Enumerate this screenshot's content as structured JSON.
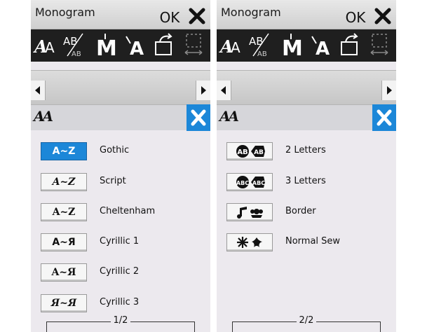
{
  "panels": [
    {
      "title": "Monogram",
      "ok_label": "OK",
      "subheader_icon": "AA",
      "items": [
        {
          "button": "A~Z",
          "label": "Gothic"
        },
        {
          "button": "A~Z",
          "label": "Script"
        },
        {
          "button": "A~Z",
          "label": "Cheltenham"
        },
        {
          "button": "A~Я",
          "label": "Cyrillic 1"
        },
        {
          "button": "A~Я",
          "label": "Cyrillic 2"
        },
        {
          "button": "Я~Я",
          "label": "Cyrillic 3"
        }
      ],
      "page_indicator": "1/2"
    },
    {
      "title": "Monogram",
      "ok_label": "OK",
      "subheader_icon": "AA",
      "items": [
        {
          "button_icon": "two-letter-monogram-icon",
          "label": "2 Letters"
        },
        {
          "button_icon": "three-letter-monogram-icon",
          "label": "3 Letters"
        },
        {
          "button_icon": "border-icon",
          "label": "Border"
        },
        {
          "button_icon": "normal-sew-icon",
          "label": "Normal Sew"
        }
      ],
      "page_indicator": "2/2"
    }
  ],
  "colors": {
    "accent_blue": "#1c87d8",
    "toolbar_black": "#1f1f1f",
    "panel_bg": "#ece9ee"
  },
  "toolbar_icons": [
    "font-style-icon",
    "letter-size-icon",
    "monogram-m-icon",
    "letter-spacing-icon",
    "rotate-icon",
    "selection-icon"
  ]
}
